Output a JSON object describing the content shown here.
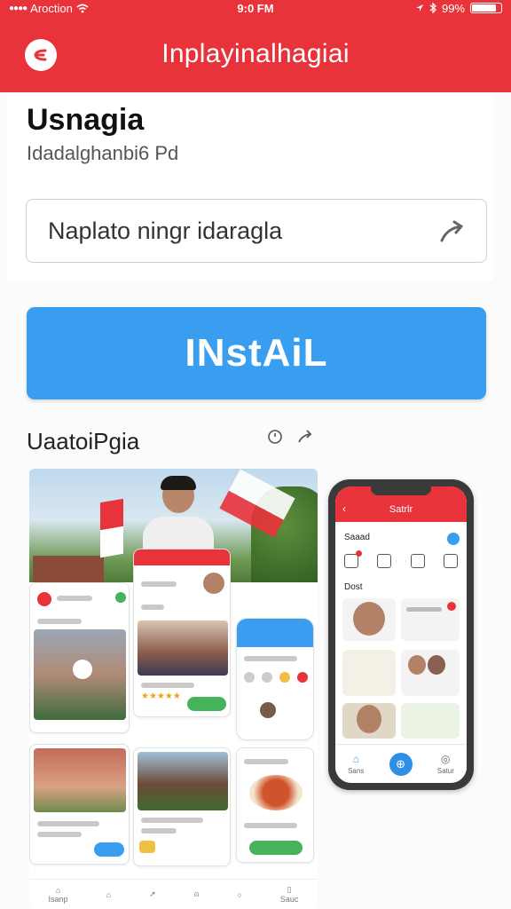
{
  "status": {
    "carrier": "Aroction",
    "time": "9:0 FM",
    "battery": "99%"
  },
  "appbar": {
    "title": "Inplayinalhagiai"
  },
  "header": {
    "app_name": "Usnagia",
    "subtitle": "Idadalghanbi6 Pd"
  },
  "search": {
    "value": "Naplato ningr idaragla"
  },
  "install": {
    "label": "INstAiL"
  },
  "section": {
    "title": "UaatoiPgia"
  },
  "collage": {
    "nav": [
      "Isanp",
      "",
      "",
      "",
      "",
      "Sauc"
    ]
  },
  "phone": {
    "title": "Satrlr",
    "label1": "Saaad",
    "label2": "Dost",
    "nav": [
      "Sans",
      "",
      "Satur"
    ]
  },
  "colors": {
    "brand_red": "#e8333a",
    "install_blue": "#3a9ef0"
  }
}
